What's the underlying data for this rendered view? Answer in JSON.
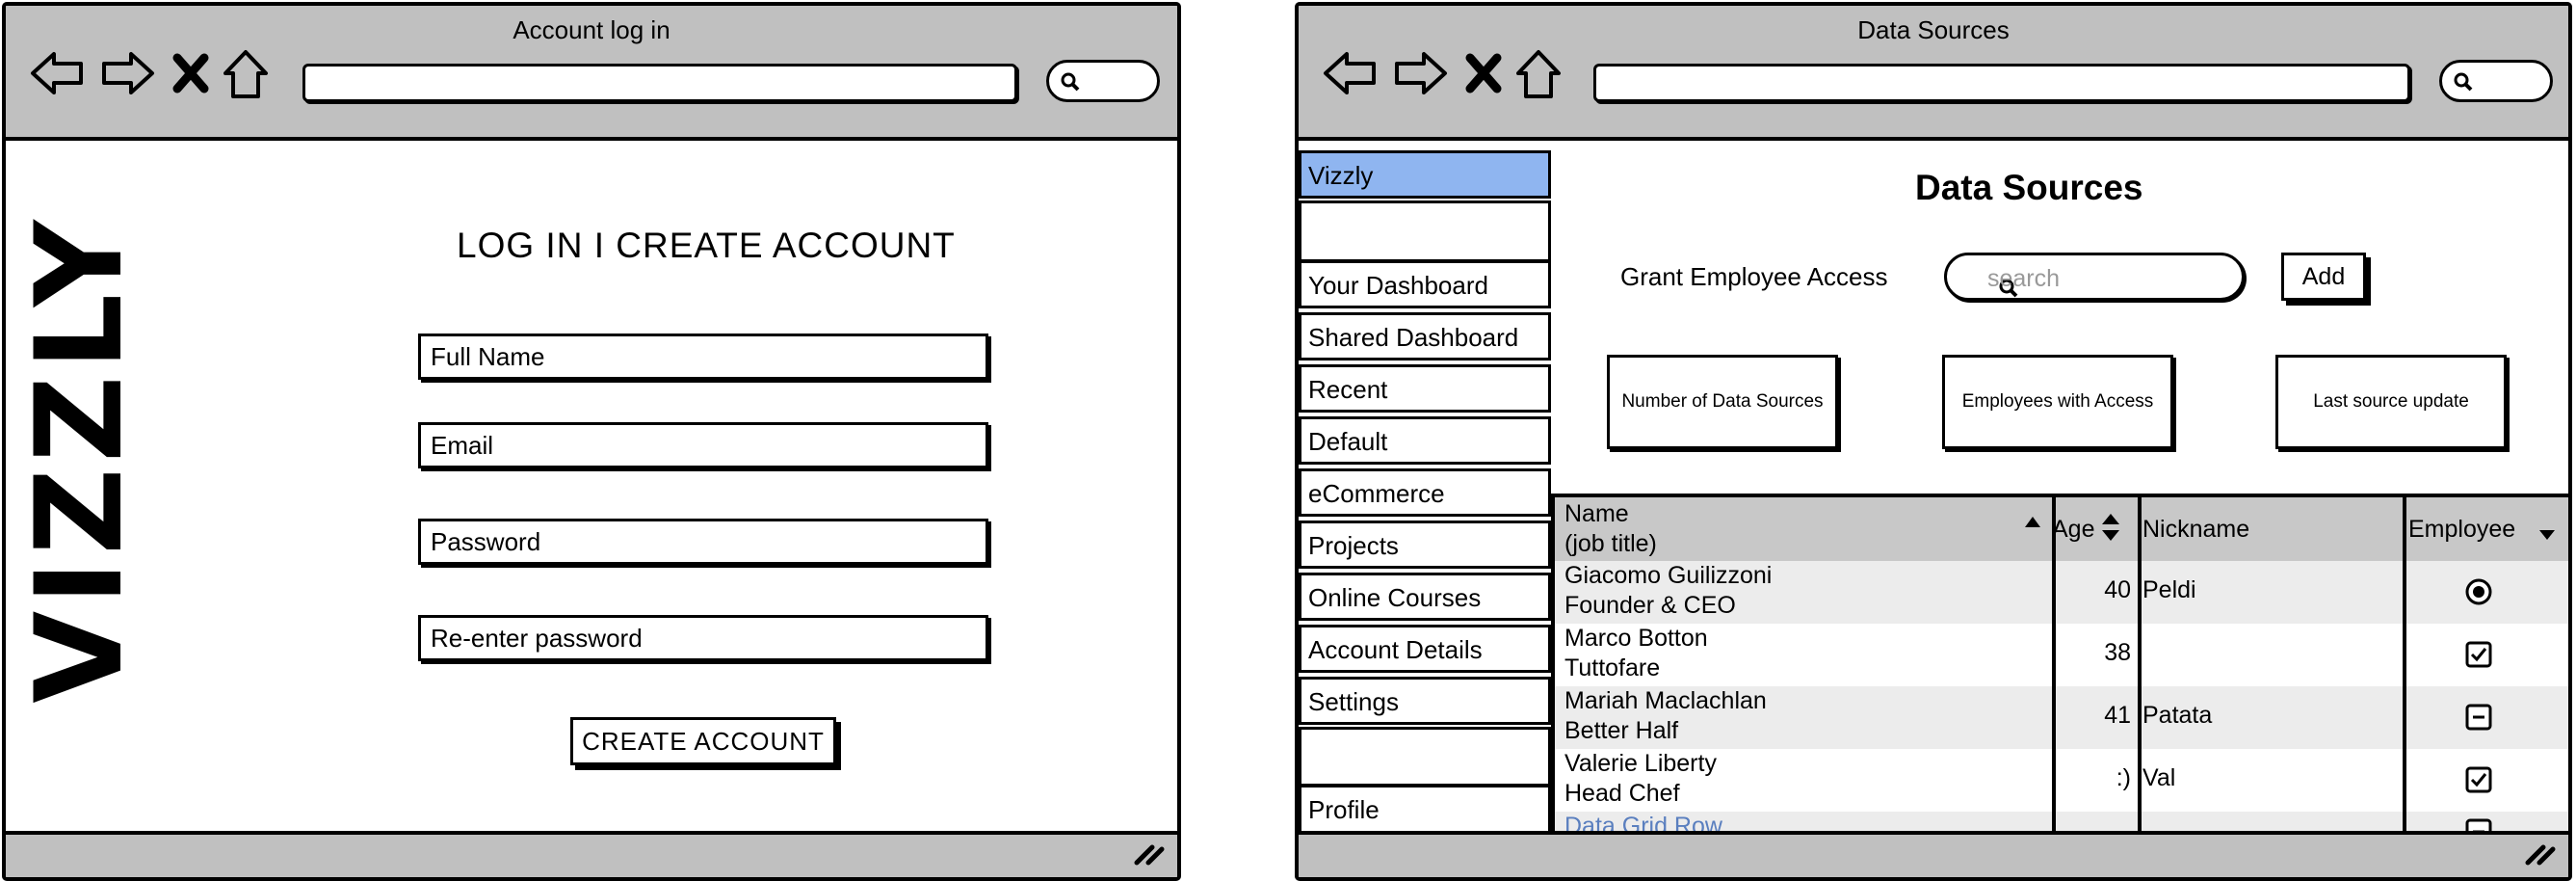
{
  "login_window": {
    "title": "Account log in",
    "logo_text": "VIZZLY",
    "heading": "LOG IN I CREATE ACCOUNT",
    "fields": [
      "Full Name",
      "Email",
      "Password",
      "Re-enter password"
    ],
    "create_button": "CREATE ACCOUNT"
  },
  "ds_window": {
    "title": "Data Sources",
    "sidebar": {
      "items": [
        "Vizzly",
        "",
        "Your Dashboard",
        "Shared Dashboard",
        "Recent",
        "Default",
        "eCommerce",
        "Projects",
        "Online Courses",
        "Account Details",
        "Settings",
        "",
        "Profile"
      ],
      "selected": "Vizzly"
    },
    "heading": "Data Sources",
    "grant_label": "Grant Employee Access",
    "search_placeholder": "search",
    "add_button": "Add",
    "stats": [
      "Number of Data Sources",
      "Employees with Access",
      "Last source update"
    ],
    "grid": {
      "headers": {
        "name": "Name",
        "name_sub": "(job title)",
        "age": "Age",
        "nickname": "Nickname",
        "employee": "Employee"
      },
      "rows": [
        {
          "name": "Giacomo Guilizzoni",
          "title": "Founder & CEO",
          "age": "40",
          "nickname": "Peldi",
          "employee": "radio-selected"
        },
        {
          "name": "Marco Botton",
          "title": "Tuttofare",
          "age": "38",
          "nickname": "",
          "employee": "checked"
        },
        {
          "name": "Mariah Maclachlan",
          "title": "Better Half",
          "age": "41",
          "nickname": "Patata",
          "employee": "indeterminate"
        },
        {
          "name": "Valerie Liberty",
          "title": "Head Chef",
          "age": ":)",
          "nickname": "Val",
          "employee": "checked"
        }
      ],
      "partial_row": {
        "name": "Data Grid Row",
        "employee": "indeterminate"
      },
      "link_color": "#5a7fbf"
    },
    "colors": {
      "selected_item": "#8fb5f0",
      "chrome": "#c0c0c0",
      "header": "#c8c8c8",
      "alt_row": "#ececec"
    }
  }
}
